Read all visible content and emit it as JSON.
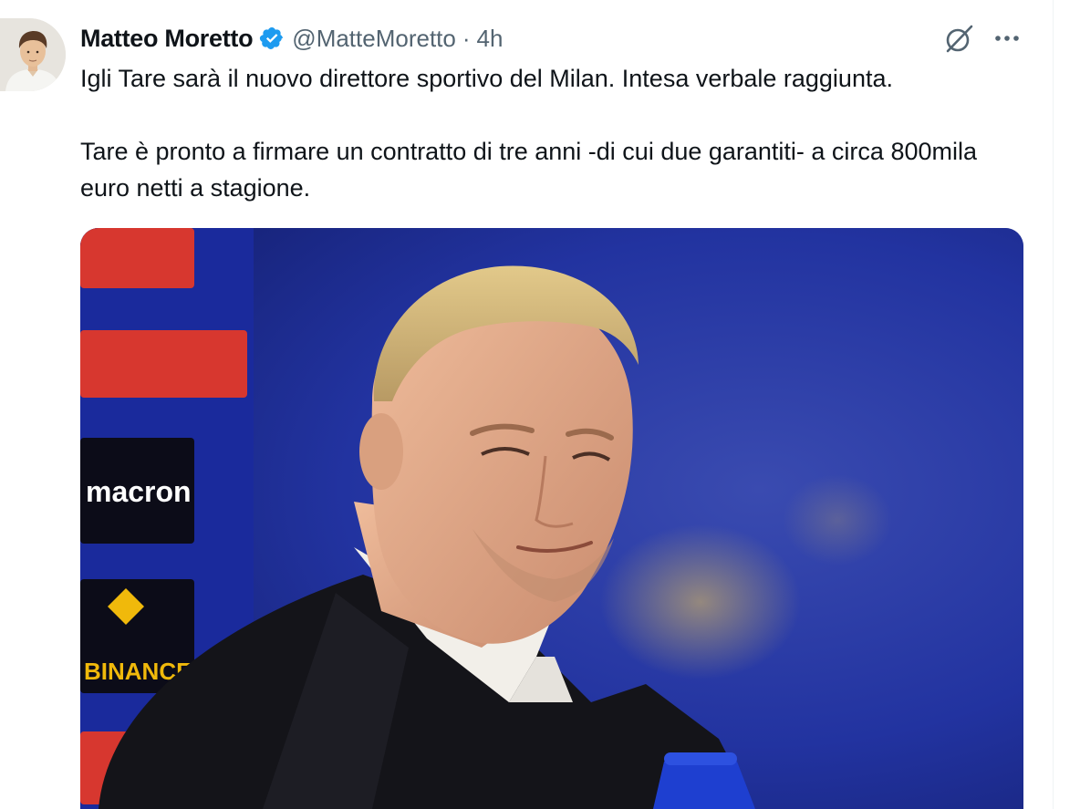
{
  "author": {
    "display_name": "Matteo Moretto",
    "handle": "@MatteMoretto",
    "separator": "·",
    "time": "4h",
    "verified": true
  },
  "tweet": {
    "paragraphs": [
      "Igli Tare sarà il nuovo direttore sportivo del Milan. Intesa verbale raggiunta.",
      "Tare è pronto a firmare un contratto di tre anni -di cui due garantiti- a circa 800mila euro netti a stagione."
    ]
  },
  "media": {
    "sponsor_boards": [
      "macron",
      "BINANCE"
    ]
  },
  "icons": {
    "verified": "verified-badge-icon",
    "grok": "grok-icon",
    "more": "more-options-icon"
  },
  "colors": {
    "text": "#0f1419",
    "secondary": "#536471",
    "verified": "#1d9bf0",
    "photo_background": "#1e2a8a"
  }
}
